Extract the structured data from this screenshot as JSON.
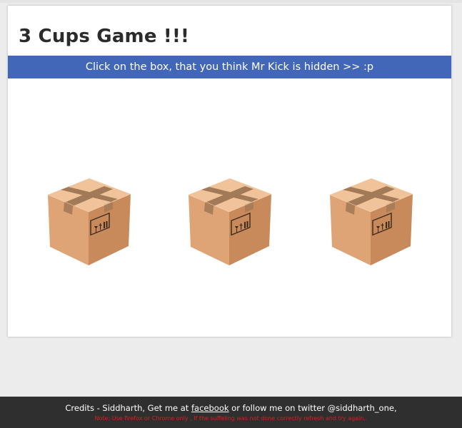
{
  "title": "3 Cups Game !!!",
  "banner": "Click on the box, that you think Mr Kick is hidden >> :p",
  "boxes": [
    {
      "name": "box-1"
    },
    {
      "name": "box-2"
    },
    {
      "name": "box-3"
    }
  ],
  "footer": {
    "credits_prefix": "Credits - Siddharth, Get me at ",
    "facebook_link": "facebook",
    "credits_suffix": " or follow me on twitter @siddharth_one,",
    "note": "Note: Use firefox or Chrome only , If the suffeling was not done correctly refresh and try again.."
  },
  "colors": {
    "banner": "#4267b8",
    "footer": "#2f2f2f",
    "note": "#d62020",
    "box_left": "#dea475",
    "box_right": "#c88a5b",
    "box_top": "#f0c39b",
    "tape": "#a37a57"
  }
}
